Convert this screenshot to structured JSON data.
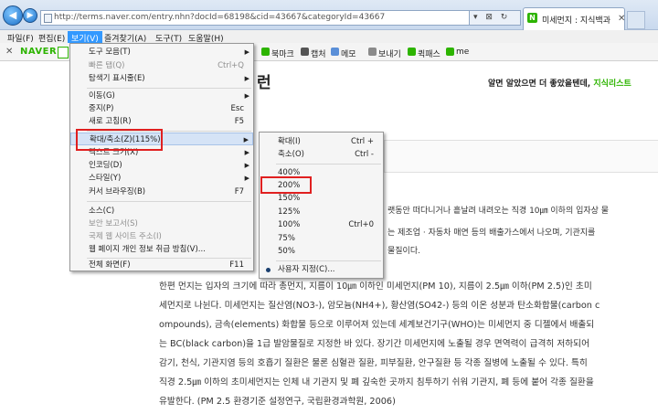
{
  "browser": {
    "url": "http://terms.naver.com/entry.nhn?docId=68198&cid=43667&categoryId=43667",
    "tab_title": "미세먼지 : 지식백과",
    "tab_icon": "N",
    "address_tools": "▾ ⊠ ↻",
    "back_icon": "back-arrow-icon",
    "forward_icon": "forward-arrow-icon"
  },
  "menubar": [
    "파일(F)",
    "편집(E)",
    "보기(V)",
    "즐겨찾기(A)",
    "도구(T)",
    "도움말(H)"
  ],
  "toolbar": {
    "logo": "NAVER",
    "items": [
      "북마크",
      "캡처",
      "메모",
      "보내기",
      "퀵패스",
      "me"
    ],
    "icon_colors": [
      "#2db400",
      "#555555",
      "#5a8fd8",
      "#8a8a8a",
      "#2db400",
      "#2db400"
    ]
  },
  "view_menu": [
    {
      "label": "도구 모음(T)",
      "arrow": true
    },
    {
      "label": "빠른 탭(Q)",
      "shortcut": "Ctrl+Q",
      "disabled": true
    },
    {
      "label": "탐색기 표시줄(E)",
      "arrow": true
    },
    {
      "label": "이동(G)",
      "arrow": true
    },
    {
      "label": "중지(P)",
      "shortcut": "Esc"
    },
    {
      "label": "새로 고침(R)",
      "shortcut": "F5"
    },
    {
      "label": "확대/축소(Z)(115%)",
      "arrow": true,
      "highlighted": true
    },
    {
      "label": "텍스트 크기(X)",
      "arrow": true
    },
    {
      "label": "인코딩(D)",
      "arrow": true
    },
    {
      "label": "스타일(Y)",
      "arrow": true
    },
    {
      "label": "커서 브라우징(B)",
      "shortcut": "F7"
    },
    {
      "label": "소스(C)"
    },
    {
      "label": "보안 보고서(S)",
      "disabled": true
    },
    {
      "label": "국제 웹 사이트 주소(I)",
      "disabled": true
    },
    {
      "label": "웹 페이지 개인 정보 취급 방침(V)..."
    },
    {
      "label": "전체 화면(F)",
      "shortcut": "F11"
    }
  ],
  "zoom_menu": [
    {
      "label": "확대(I)",
      "shortcut": "Ctrl +"
    },
    {
      "label": "축소(O)",
      "shortcut": "Ctrl -"
    },
    {
      "label": "400%"
    },
    {
      "label": "200%"
    },
    {
      "label": "150%"
    },
    {
      "label": "125%"
    },
    {
      "label": "100%",
      "shortcut": "Ctrl+0"
    },
    {
      "label": "75%"
    },
    {
      "label": "50%"
    },
    {
      "label": "사용자 지정(C)...",
      "selected": true
    }
  ],
  "page": {
    "heading_fragment": "런",
    "tagline": "알면 알았으면 더 좋았을텐데, ",
    "tagline_link": "지식리스트",
    "visible_fragments": [
      "랫동안 떠다니거나 흩날려 내려오는 직경 10㎛ 이하의 입자상 물",
      "는 제조업 · 자동차 매연 등의 배출가스에서 나오며, 기관지를",
      "물질이다."
    ],
    "paragraph": [
      "한편 먼지는 입자의 크기에 따라 총먼지, 지름이 10㎛ 이하인 미세먼지(PM 10), 지름이 2.5㎛ 이하(PM 2.5)인 초미",
      "세먼지로 나뉜다. 미세먼지는 질산염(NO3-), 암모늄(NH4+), 황산염(SO42-) 등의 이온 성분과 탄소화합물(carbon c",
      "ompounds), 금속(elements) 화합물 등으로 이루어져 있는데 세계보건기구(WHO)는 미세먼지 중 디젤에서 배출되",
      "는 BC(black carbon)을 1급 발암물질로 지정한 바 있다. 장기간 미세먼지에 노출될 경우 면역력이 급격히 저하되어",
      "감기, 천식, 기관지염 등의 호흡기 질환은 물론 심혈관 질환, 피부질환, 안구질환 등 각종 질병에 노출될 수 있다. 특히",
      "직경 2.5㎛ 이하의 초미세먼지는 인체 내 기관지 및 폐 깊숙한 곳까지 침투하기 쉬워 기관지, 폐 등에 붙어 각종 질환을",
      "유발한다. (PM 2.5 환경기준 설정연구, 국립환경과학원, 2006)"
    ]
  },
  "colors": {
    "highlight_box": "#e02020",
    "menu_active": "#3399ff",
    "naver_green": "#2db400"
  }
}
